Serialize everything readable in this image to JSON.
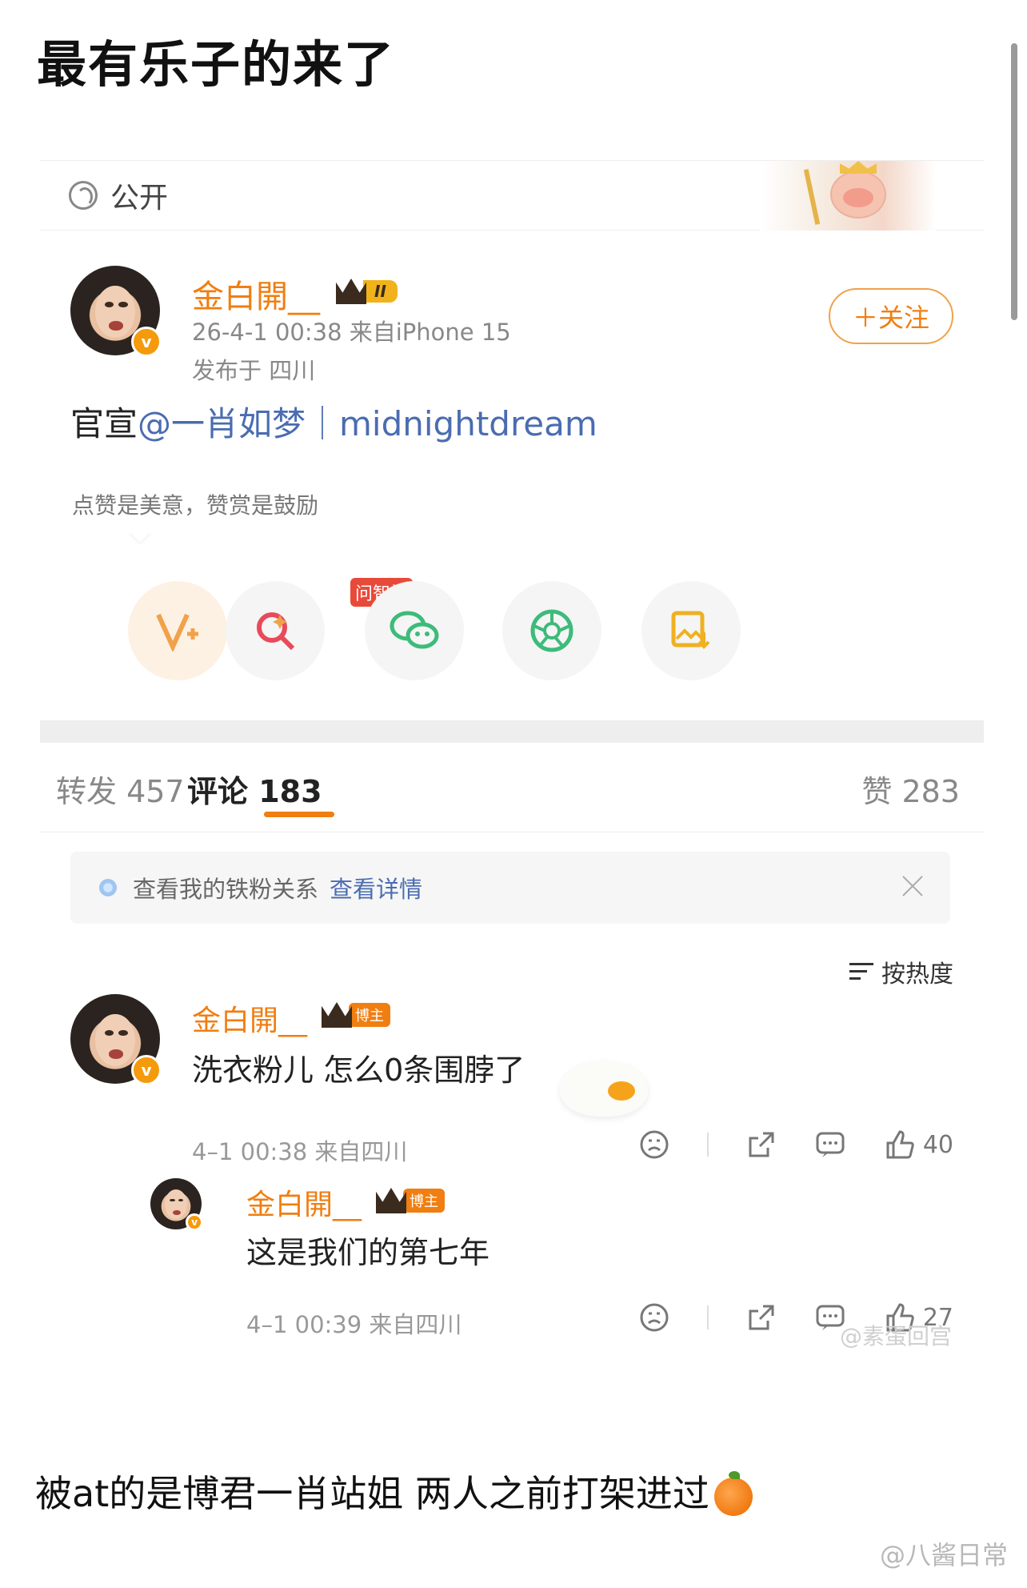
{
  "headline": "最有乐子的来了",
  "post": {
    "visibility": "公开",
    "author": "金白開__",
    "level_badge": "II",
    "time_source": "26-4-1 00:38  来自iPhone 15",
    "location": "发布于 四川",
    "follow_label": "＋关注",
    "text_prefix": "官宣",
    "text_mention": "@一肖如梦｜midnightdream",
    "reward_tip": "点赞是美意，赞赏是鼓励",
    "ask_badge": "问智搜",
    "action_icons": [
      "reward-v-icon",
      "ask-search-icon",
      "wechat-icon",
      "moments-icon",
      "save-image-icon"
    ]
  },
  "tabs": {
    "repost": "转发 457",
    "comments": "评论 183",
    "likes": "赞 283"
  },
  "fan_bar": {
    "text": "查看我的铁粉关系",
    "link": "查看详情"
  },
  "sort_label": "按热度",
  "comments": [
    {
      "author": "金白開__",
      "badge": "博主",
      "text": "洗衣粉儿 怎么0条围脖了",
      "time": "4–1 00:38  来自四川",
      "likes": "40"
    },
    {
      "author": "金白開__",
      "badge": "博主",
      "text": "这是我们的第七年",
      "time": "4–1 00:39  来自四川",
      "likes": "27"
    }
  ],
  "inner_watermark": "@素蛋回宫",
  "caption": "被at的是博君一肖站姐 两人之前打架进过",
  "footer_watermark": "@八酱日常",
  "colors": {
    "accent": "#f07e11",
    "link": "#4a6cb1"
  }
}
